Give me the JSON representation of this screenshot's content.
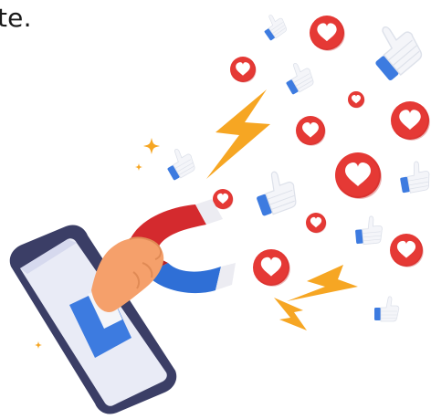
{
  "caption": {
    "text": "te."
  },
  "illustration": {
    "subject": "hand-with-magnet-from-phone-attracting-likes-and-hearts",
    "icons": [
      "heart-icon",
      "thumbs-up-icon",
      "lightning-icon",
      "sparkle-icon",
      "magnet-icon",
      "smartphone-icon",
      "hand-icon"
    ]
  },
  "colors": {
    "heart_red": "#e53935",
    "heart_white": "#ffffff",
    "thumb_blue": "#3d7be0",
    "thumb_white": "#f4f5f9",
    "bolt_orange": "#f6a623",
    "magnet_red": "#d42a2e",
    "magnet_blue": "#2f6fd6",
    "phone_frame": "#3b3e66",
    "skin": "#f5a06b",
    "sparkle": "#f6a623"
  }
}
